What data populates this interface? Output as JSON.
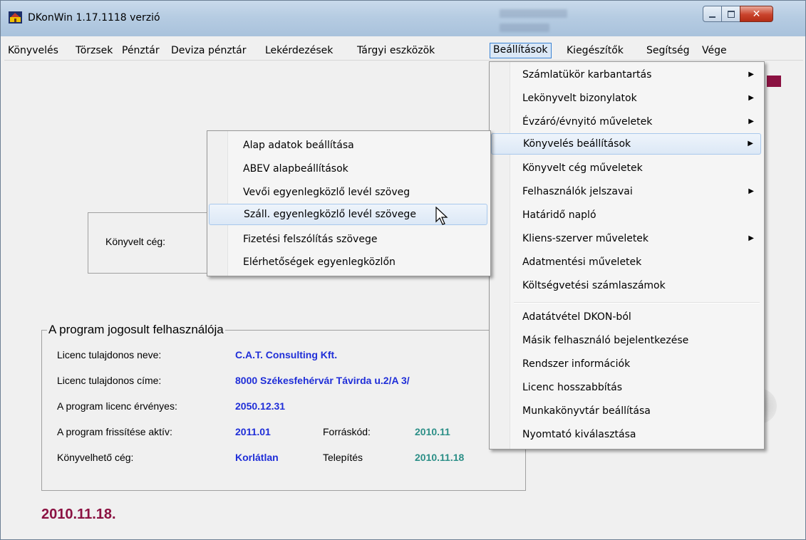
{
  "window": {
    "title": "DKonWin 1.17.1118 verzió",
    "controls": [
      "minimize",
      "maximize",
      "close"
    ]
  },
  "menubar": [
    {
      "label": "Könyvelés"
    },
    {
      "label": "Törzsek"
    },
    {
      "label": "Pénztár"
    },
    {
      "label": "Deviza pénztár"
    },
    {
      "label": "Lekérdezések"
    },
    {
      "label": "Tárgyi eszközök"
    },
    {
      "label": "Beállítások",
      "active": true
    },
    {
      "label": "Kiegészítők"
    },
    {
      "label": "Segítség"
    },
    {
      "label": "Vége"
    }
  ],
  "beallitasok_menu": [
    {
      "label": "Számlatükör karbantartás",
      "submenu": true
    },
    {
      "label": "Lekönyvelt bizonylatok",
      "submenu": true
    },
    {
      "label": "Évzáró/évnyitó műveletek",
      "submenu": true
    },
    {
      "label": "Könyvelés beállítások",
      "submenu": true,
      "highlighted": true
    },
    {
      "label": "Könyvelt cég műveletek",
      "submenu": false
    },
    {
      "label": "Felhasználók jelszavai",
      "submenu": true
    },
    {
      "label": "Határidő napló",
      "submenu": false
    },
    {
      "label": "Kliens-szerver műveletek",
      "submenu": true
    },
    {
      "label": "Adatmentési műveletek",
      "submenu": false
    },
    {
      "label": "Költségvetési számlaszámok",
      "submenu": false
    },
    {
      "label": "Adatátvétel DKON-ból",
      "submenu": false
    },
    {
      "label": "Másik felhasználó bejelentkezése",
      "submenu": false
    },
    {
      "label": "Rendszer információk",
      "submenu": false
    },
    {
      "label": "Licenc hosszabbítás",
      "submenu": false
    },
    {
      "label": "Munkakönyvtár beállítása",
      "submenu": false
    },
    {
      "label": "Nyomtató kiválasztása",
      "submenu": false
    }
  ],
  "konyveles_submenu": [
    {
      "label": "Alap adatok beállítása"
    },
    {
      "label": "ABEV alapbeállítások"
    },
    {
      "label": "Vevői egyenlegközlő levél szöveg"
    },
    {
      "label": "Száll. egyenlegközlő levél szövege",
      "highlighted": true
    },
    {
      "label": "Fizetési felszólítás szövege"
    },
    {
      "label": "Elérhetőségek egyenlegközlőn"
    }
  ],
  "company_box": {
    "label": "Könyvelt cég:"
  },
  "license": {
    "title": "A program jogosult felhasználója",
    "owner_name_label": "Licenc tulajdonos neve:",
    "owner_name": "C.A.T. Consulting Kft.",
    "owner_address_label": "Licenc tulajdonos címe:",
    "owner_address": "8000 Székesfehérvár Távirda u.2/A 3/",
    "valid_label": "A program licenc érvényes:",
    "valid": "2050.12.31",
    "update_label": "A program frissítése aktív:",
    "update": "2011.01",
    "source_label": "Forráskód:",
    "source": "2010.11",
    "company_label": "Könyvelhető cég:",
    "company": "Korlátlan",
    "install_label": "Telepítés",
    "install": "2010.11.18"
  },
  "current_date": "2010.11.18.",
  "colors": {
    "accent": "#8b1242",
    "value_blue": "#1f2ed8",
    "value_teal": "#2c8f87",
    "highlight": "#dce8f6"
  }
}
